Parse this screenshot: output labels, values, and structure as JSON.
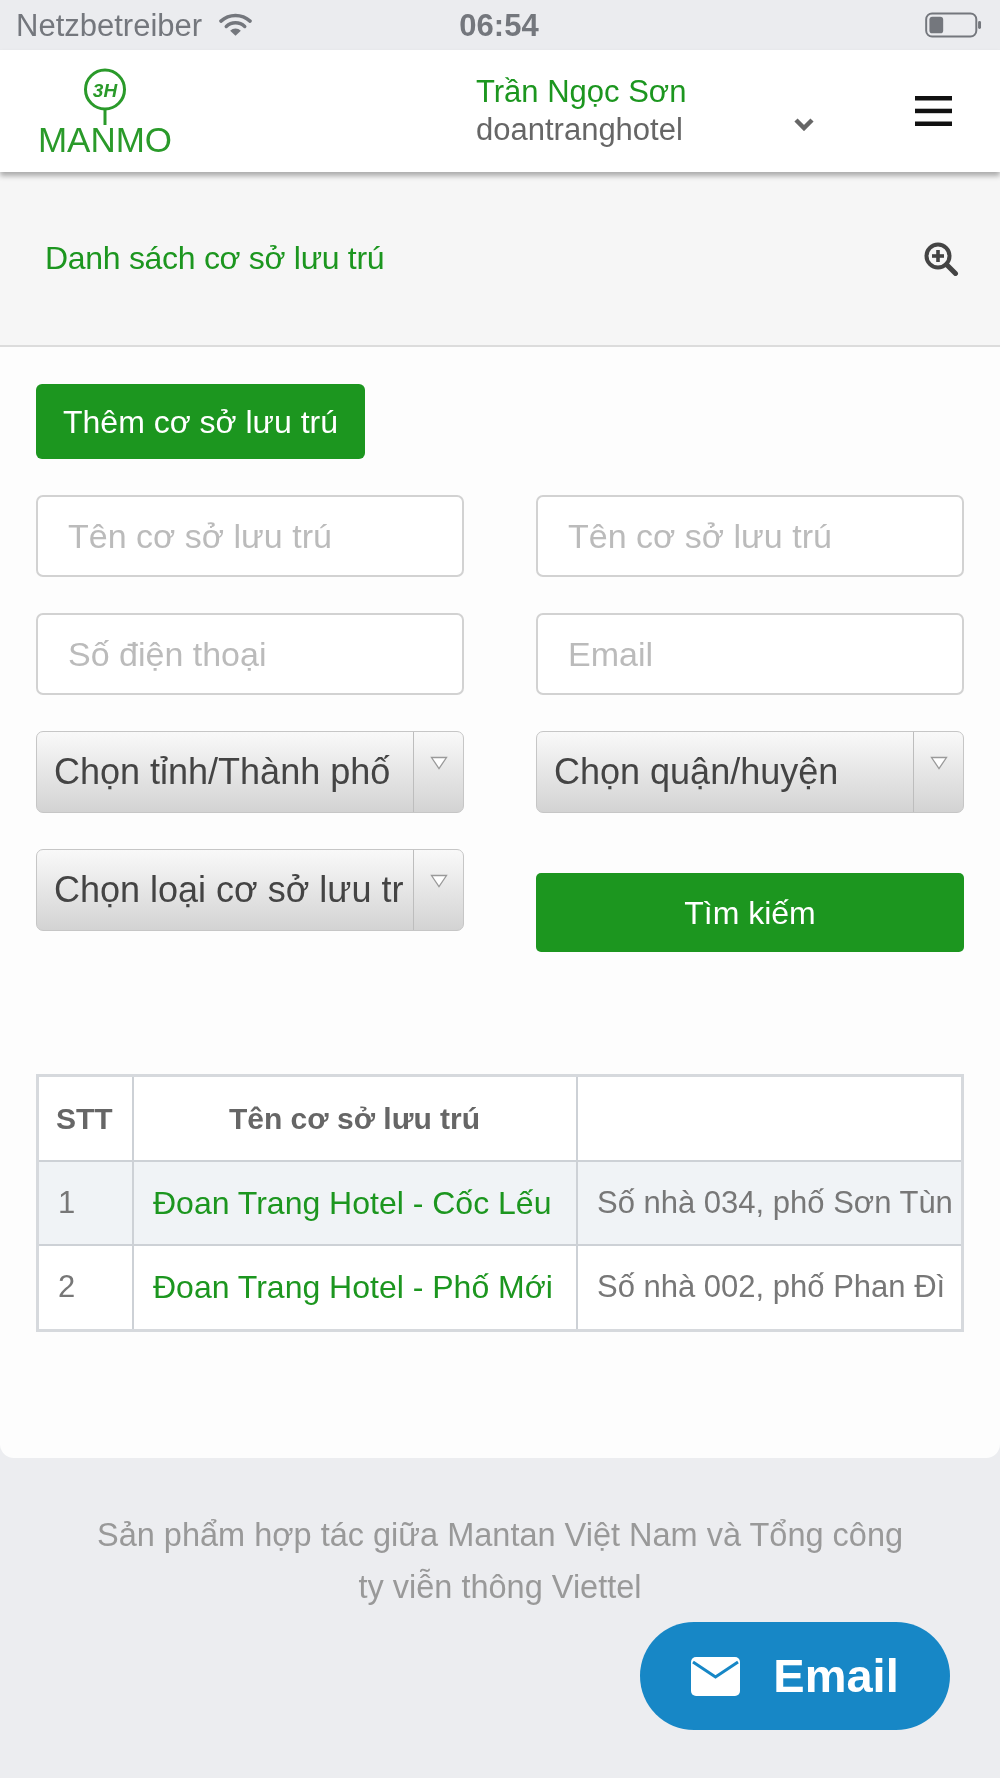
{
  "status_bar": {
    "carrier": "Netzbetreiber",
    "time": "06:54"
  },
  "header": {
    "logo": {
      "monogram": "3H",
      "wordmark": "MANMO"
    },
    "user": {
      "name": "Trần Ngọc Sơn",
      "account": "doantranghotel"
    }
  },
  "page_title": "Danh sách cơ sở lưu trú",
  "add_button": {
    "label": "Thêm cơ sở lưu trú"
  },
  "filters": [
    {
      "kind": "input",
      "placeholder": "Tên cơ sở lưu trú"
    },
    {
      "kind": "input",
      "placeholder": "Tên cơ sở lưu trú"
    },
    {
      "kind": "input",
      "placeholder": "Số điện thoại"
    },
    {
      "kind": "input",
      "placeholder": "Email"
    },
    {
      "kind": "select",
      "value": "Chọn tỉnh/Thành phố"
    },
    {
      "kind": "select",
      "value": "Chọn quận/huyện"
    },
    {
      "kind": "select",
      "value": "Chọn loại cơ sở lưu tr"
    },
    {
      "kind": "button",
      "label": "Tìm kiếm"
    }
  ],
  "table": {
    "columns": [
      {
        "label": "STT",
        "kind": "text"
      },
      {
        "label": "Tên cơ sở lưu trú",
        "kind": "link"
      },
      {
        "kind": "text"
      }
    ],
    "rows": [
      [
        "1",
        "Đoan Trang Hotel - Cốc Lếu",
        "Số nhà 034, phố Sơn Tùn"
      ],
      [
        "2",
        "Đoan Trang Hotel - Phố Mới",
        "Số nhà 002, phố Phan Đì"
      ]
    ]
  },
  "footer": {
    "text": "Sản phẩm hợp tác giữa Mantan Việt Nam và Tổng công ty viễn thông Viettel",
    "email_button": {
      "label": "Email"
    }
  }
}
